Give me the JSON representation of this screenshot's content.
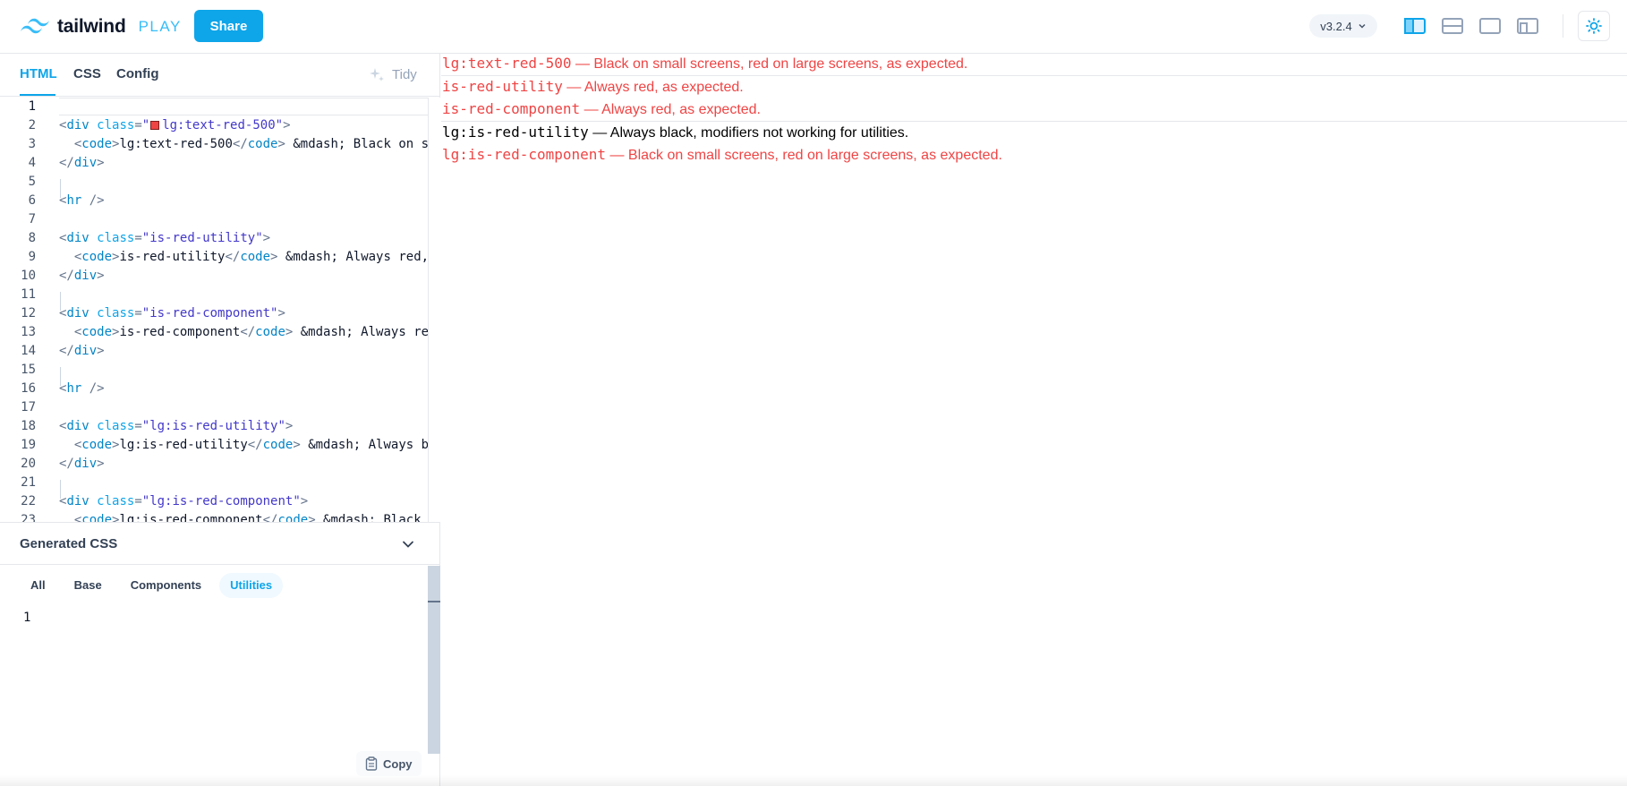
{
  "header": {
    "logo_text": "tailwind",
    "logo_suffix": "PLAY",
    "share_label": "Share",
    "version_label": "v3.2.4"
  },
  "tabs": [
    {
      "label": "HTML"
    },
    {
      "label": "CSS"
    },
    {
      "label": "Config"
    }
  ],
  "tidy_label": "Tidy",
  "editor": {
    "lines": [
      {
        "n": "1"
      },
      {
        "n": "2"
      },
      {
        "n": "3"
      },
      {
        "n": "4"
      },
      {
        "n": "5"
      },
      {
        "n": "6"
      },
      {
        "n": "7"
      },
      {
        "n": "8"
      },
      {
        "n": "9"
      },
      {
        "n": "10"
      },
      {
        "n": "11"
      },
      {
        "n": "12"
      },
      {
        "n": "13"
      },
      {
        "n": "14"
      },
      {
        "n": "15"
      },
      {
        "n": "16"
      },
      {
        "n": "17"
      },
      {
        "n": "18"
      },
      {
        "n": "19"
      },
      {
        "n": "20"
      },
      {
        "n": "21"
      },
      {
        "n": "22"
      },
      {
        "n": "23"
      }
    ],
    "code": {
      "l2_val": "lg:text-red-500",
      "l3_text": "lg:text-red-500",
      "l3_rest": " &mdash; Black on sma",
      "l8_val": "\"is-red-utility\"",
      "l9_text": "is-red-utility",
      "l9_rest": " &mdash; Always red, a",
      "l12_val": "\"is-red-component\"",
      "l13_text": "is-red-component",
      "l13_rest": " &mdash; Always red,",
      "l18_val": "\"lg:is-red-utility\"",
      "l19_text": "lg:is-red-utility",
      "l19_rest": " &mdash; Always bla",
      "l22_val": "\"lg:is-red-component\"",
      "l23_text": "lg:is-red-component",
      "l23_rest": " &mdash; Black or"
    }
  },
  "generated_css": {
    "title": "Generated CSS",
    "filters": [
      {
        "label": "All"
      },
      {
        "label": "Base"
      },
      {
        "label": "Components"
      },
      {
        "label": "Utilities",
        "active": true
      }
    ],
    "line_number": "1",
    "copy_label": "Copy"
  },
  "preview": {
    "rows": [
      {
        "code": "lg:text-red-500",
        "text": " — Black on small screens, red on large screens, as expected.",
        "color": "#ef4444"
      },
      {
        "code": "is-red-utility",
        "text": " — Always red, as expected.",
        "color": "#ef4444"
      },
      {
        "code": "is-red-component",
        "text": " — Always red, as expected.",
        "color": "#ef4444"
      },
      {
        "code": "lg:is-red-utility",
        "text": " — Always black, modifiers not working for utilities.",
        "color": "#000000"
      },
      {
        "code": "lg:is-red-component",
        "text": " — Black on small screens, red on large screens, as expected.",
        "color": "#ef4444"
      }
    ]
  },
  "colors": {
    "accent": "#0ea5e9",
    "red": "#ef4444"
  }
}
